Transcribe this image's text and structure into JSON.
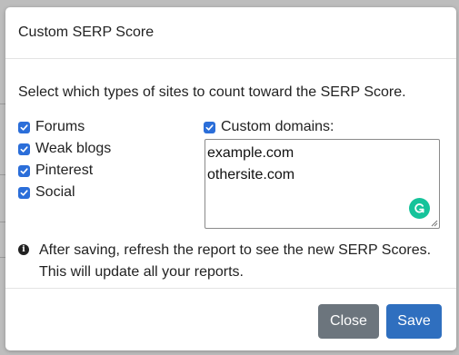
{
  "modal": {
    "title": "Custom SERP Score",
    "intro": "Select which types of sites to count toward the SERP Score.",
    "options": [
      {
        "label": "Forums",
        "checked": true
      },
      {
        "label": "Weak blogs",
        "checked": true
      },
      {
        "label": "Pinterest",
        "checked": true
      },
      {
        "label": "Social",
        "checked": true
      }
    ],
    "custom_domains": {
      "label": "Custom domains:",
      "checked": true,
      "lines": [
        "example.com",
        "othersite.com"
      ]
    },
    "note_line1": "After saving, refresh the report to see the new SERP Scores.",
    "note_line2": "This will update all your reports.",
    "close_label": "Close",
    "save_label": "Save"
  },
  "colors": {
    "checkbox": "#2b6ed9",
    "close_button": "#6c757d",
    "save_button": "#2f6fbf",
    "grammarly": "#15c39a"
  },
  "icons": {
    "info": "info-circle-icon",
    "grammarly": "grammarly-icon",
    "check": "check-icon"
  }
}
